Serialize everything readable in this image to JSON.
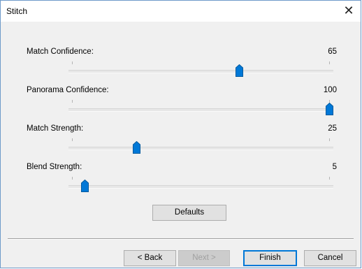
{
  "window": {
    "title": "Stitch",
    "close_glyph": "✕"
  },
  "sliders": [
    {
      "label": "Match Confidence:",
      "value": "65",
      "level": 0.65
    },
    {
      "label": "Panorama Confidence:",
      "value": "100",
      "level": 1.0
    },
    {
      "label": "Match Strength:",
      "value": "25",
      "level": 0.25
    },
    {
      "label": "Blend Strength:",
      "value": "5",
      "level": 0.05
    }
  ],
  "buttons": {
    "defaults": "Defaults",
    "back": "< Back",
    "next": "Next >",
    "finish": "Finish",
    "cancel": "Cancel"
  },
  "colors": {
    "thumb": "#0078d7",
    "accent": "#0078d7"
  },
  "icons": {
    "thumb": "slider-thumb-icon",
    "close": "close-icon"
  }
}
